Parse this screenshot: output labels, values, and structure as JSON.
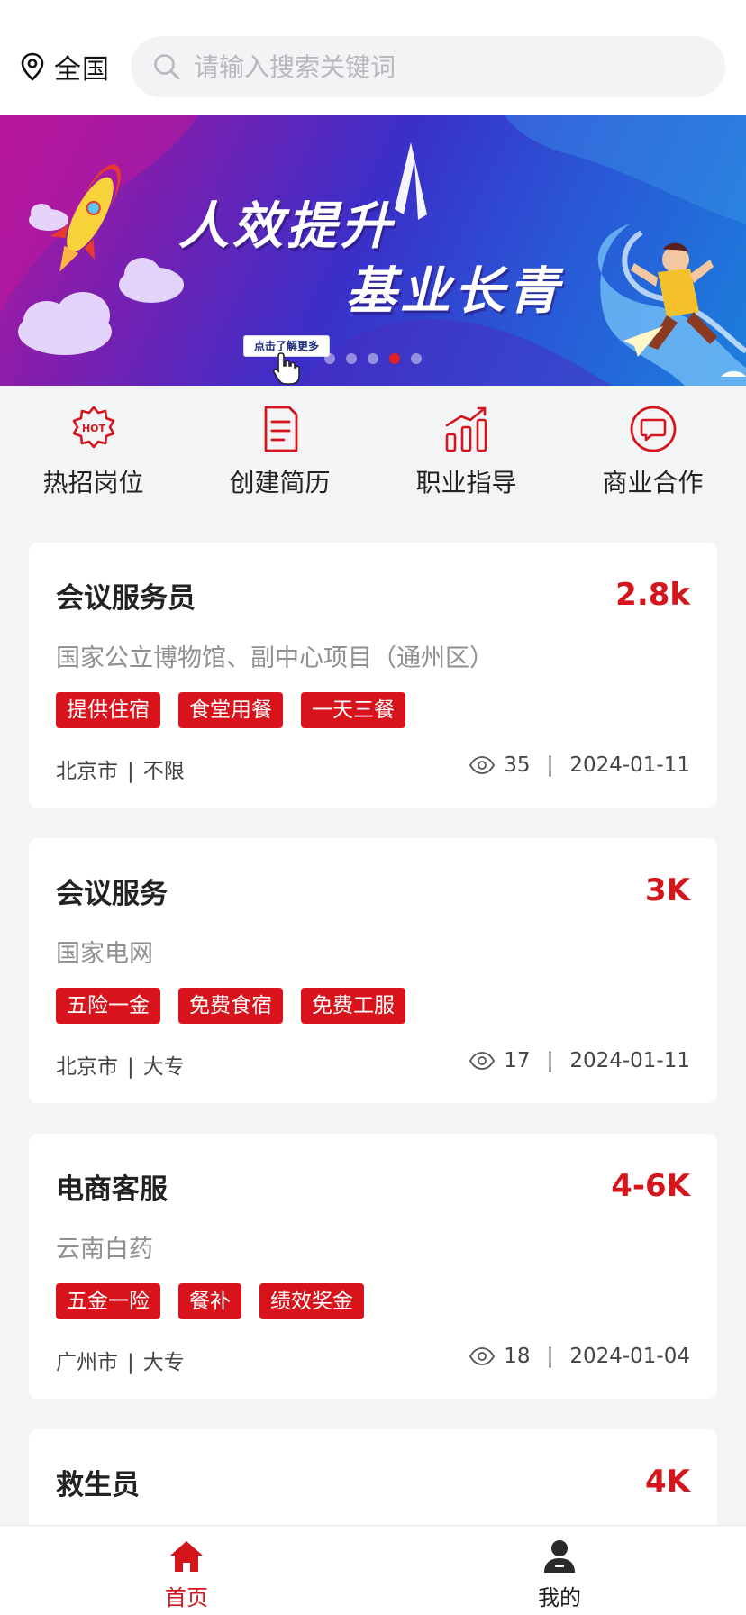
{
  "header": {
    "location": "全国",
    "search_placeholder": "请输入搜索关键词"
  },
  "banner": {
    "title_line1": "人效提升",
    "title_line2": "基业长青",
    "button_label": "点击了解更多",
    "slide_count": 5,
    "active_slide": 4
  },
  "quick_menu": [
    {
      "label": "热招岗位",
      "icon": "hot-badge-icon"
    },
    {
      "label": "创建简历",
      "icon": "document-icon"
    },
    {
      "label": "职业指导",
      "icon": "bar-chart-icon"
    },
    {
      "label": "商业合作",
      "icon": "chat-bubble-icon"
    }
  ],
  "jobs": [
    {
      "title": "会议服务员",
      "salary": "2.8k",
      "company": "国家公立博物馆、副中心项目（通州区）",
      "tags": [
        "提供住宿",
        "食堂用餐",
        "一天三餐"
      ],
      "city": "北京市",
      "education": "不限",
      "views": "35",
      "date": "2024-01-11"
    },
    {
      "title": "会议服务",
      "salary": "3K",
      "company": "国家电网",
      "tags": [
        "五险一金",
        "免费食宿",
        "免费工服"
      ],
      "city": "北京市",
      "education": "大专",
      "views": "17",
      "date": "2024-01-11"
    },
    {
      "title": "电商客服",
      "salary": "4-6K",
      "company": "云南白药",
      "tags": [
        "五金一险",
        "餐补",
        "绩效奖金"
      ],
      "city": "广州市",
      "education": "大专",
      "views": "18",
      "date": "2024-01-04"
    },
    {
      "title": "救生员",
      "salary": "4K"
    }
  ],
  "tabbar": {
    "home_label": "首页",
    "mine_label": "我的",
    "active": "home"
  },
  "colors": {
    "brand_red": "#d5151c",
    "tag_bg": "#d8131b",
    "page_bg": "#f3f4f6"
  }
}
